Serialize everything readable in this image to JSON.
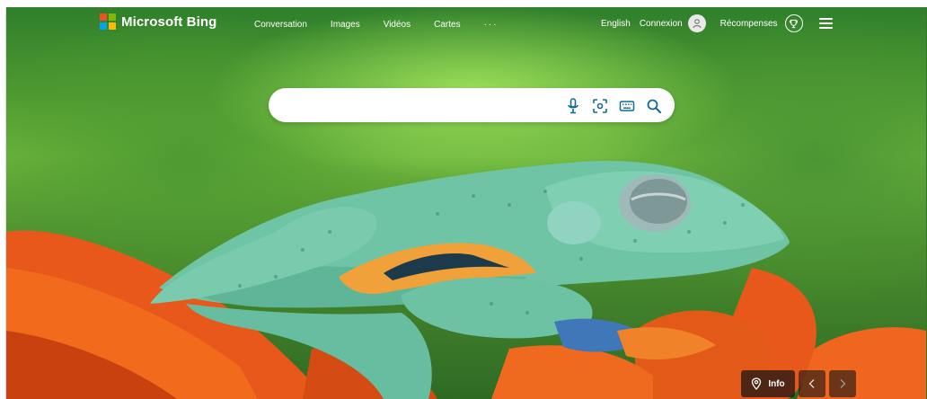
{
  "brand": {
    "name": "Microsoft Bing",
    "logo_colors": [
      "#f25022",
      "#7fba00",
      "#00a4ef",
      "#ffb900"
    ]
  },
  "nav": {
    "items": [
      "Conversation",
      "Images",
      "Vidéos",
      "Cartes"
    ],
    "more_label": "···"
  },
  "right_nav": {
    "language": "English",
    "signin": "Connexion",
    "rewards": "Récompenses",
    "icons": [
      "user-icon",
      "trophy-icon",
      "hamburger-menu-icon"
    ]
  },
  "search": {
    "value": "",
    "placeholder": "",
    "icons": [
      "microphone-icon",
      "visual-search-icon",
      "keyboard-icon",
      "search-icon"
    ],
    "accent_color": "#0f6b8f"
  },
  "bottom": {
    "info_label": "Info",
    "icons": [
      "location-pin-icon",
      "chevron-left-icon",
      "chevron-right-icon"
    ]
  }
}
